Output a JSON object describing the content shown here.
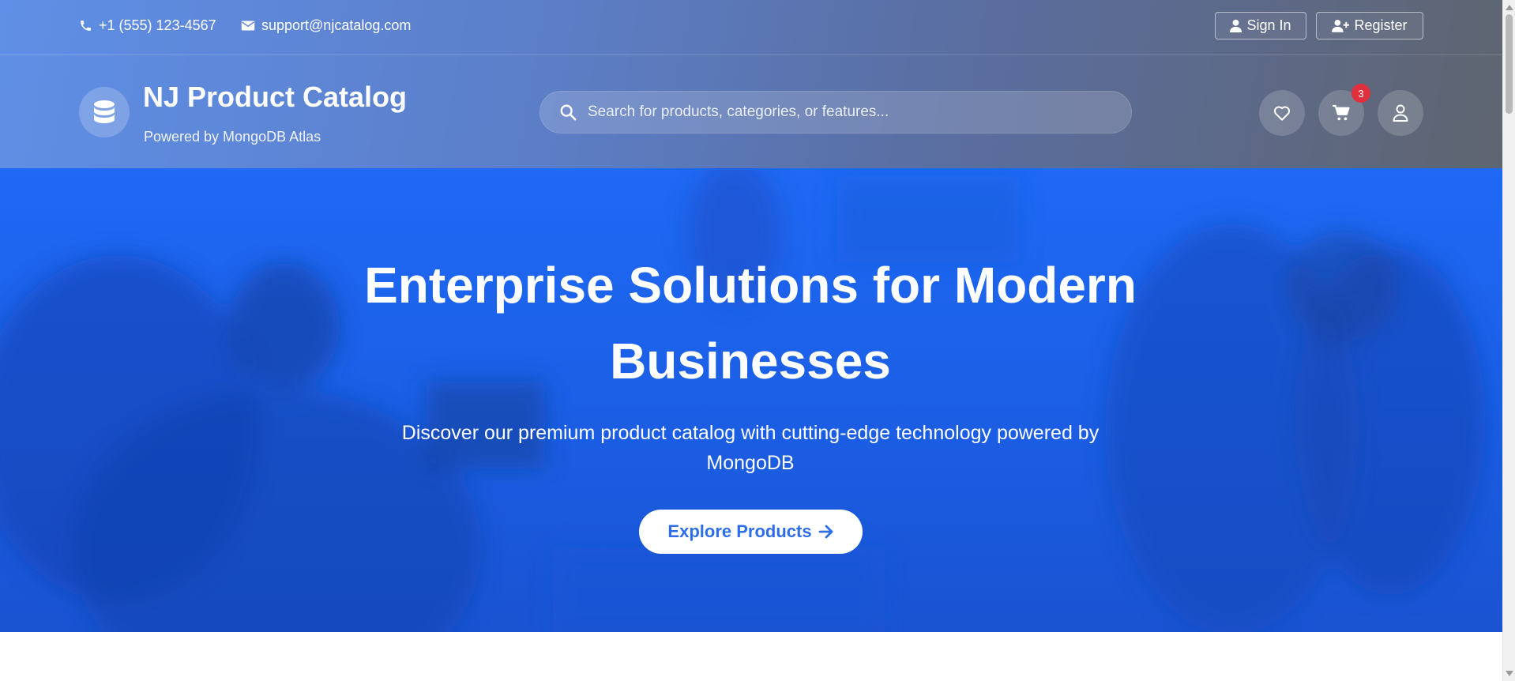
{
  "topbar": {
    "phone": "+1 (555) 123-4567",
    "email": "support@njcatalog.com",
    "sign_in_label": "Sign In",
    "register_label": "Register"
  },
  "brand": {
    "title": "NJ Product Catalog",
    "subtitle": "Powered by MongoDB Atlas",
    "logo_icon": "database-icon"
  },
  "search": {
    "placeholder": "Search for products, categories, or features...",
    "value": ""
  },
  "actions": {
    "wishlist_icon": "heart-icon",
    "cart_icon": "cart-icon",
    "cart_count": "3",
    "account_icon": "user-icon"
  },
  "hero": {
    "title": "Enterprise Solutions for Modern Businesses",
    "subtitle": "Discover our premium product catalog with cutting-edge technology powered by MongoDB",
    "cta_label": "Explore Products"
  },
  "colors": {
    "hero_blue": "#1f69f5",
    "cta_text": "#2d6ee8",
    "badge_red": "#e0303e"
  }
}
